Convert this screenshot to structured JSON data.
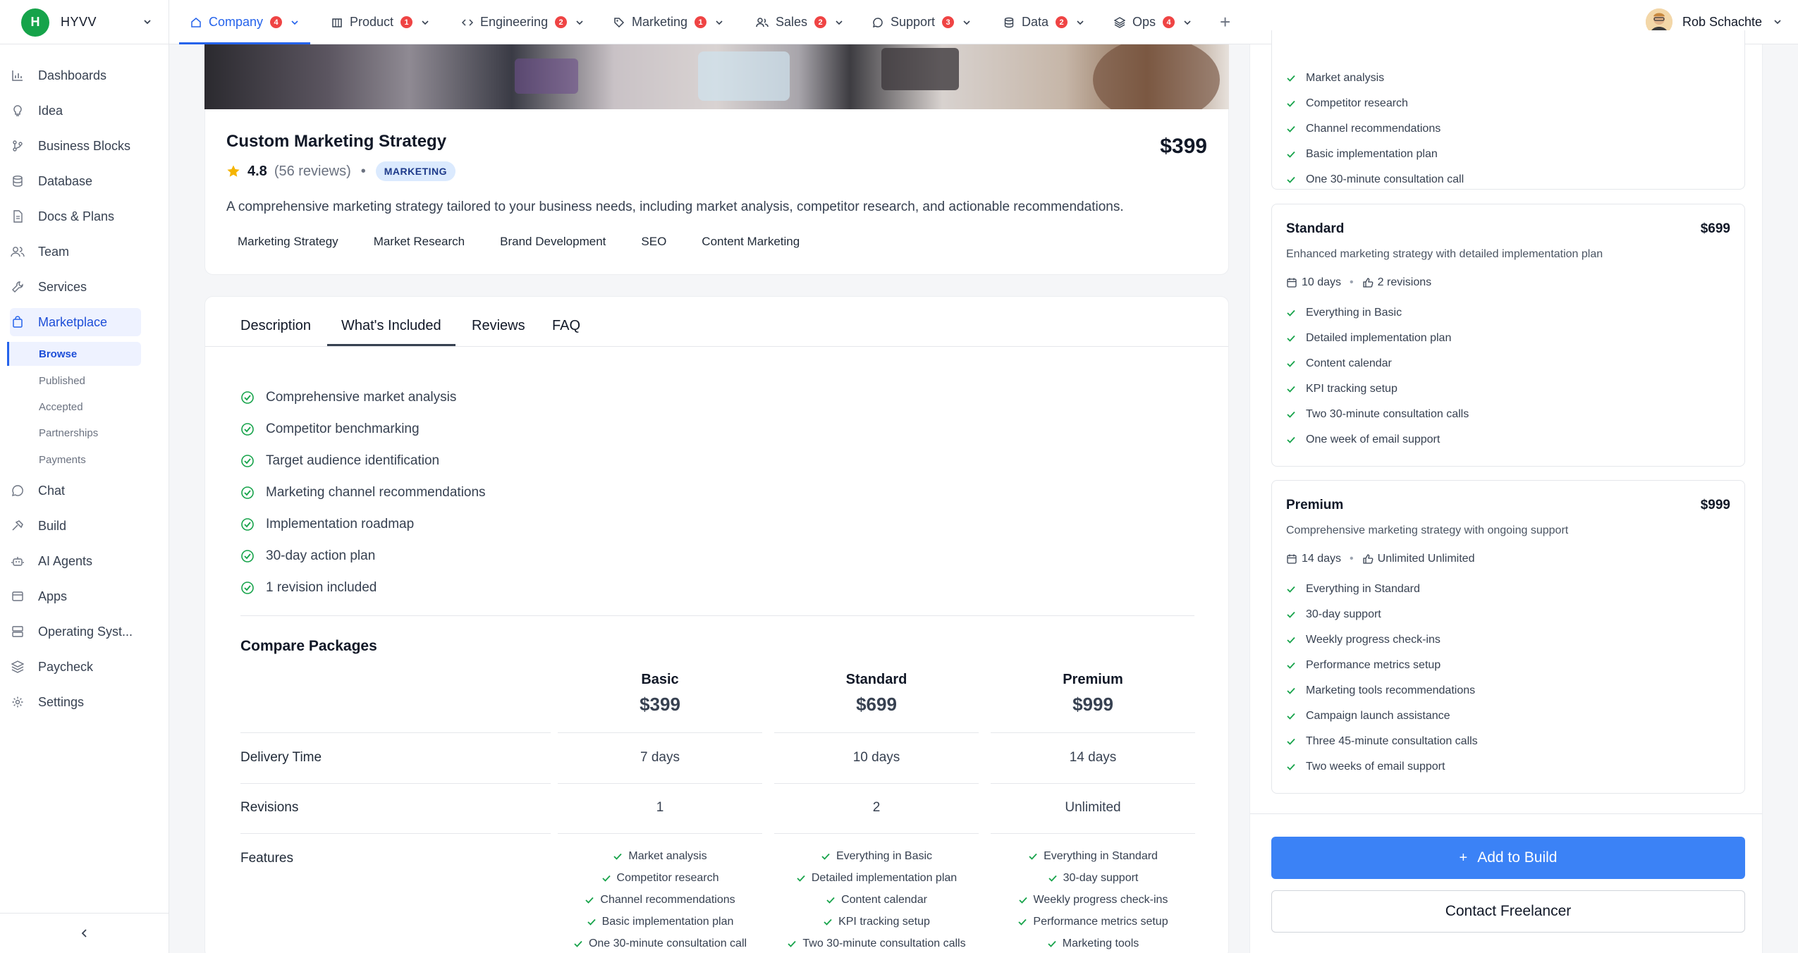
{
  "brand": {
    "initial": "H",
    "name": "HYVV"
  },
  "nav": {
    "tabs": [
      {
        "label": "Company",
        "badge": "4",
        "icon": "home-icon"
      },
      {
        "label": "Product",
        "badge": "1",
        "icon": "box-icon"
      },
      {
        "label": "Engineering",
        "badge": "2",
        "icon": "code-icon"
      },
      {
        "label": "Marketing",
        "badge": "1",
        "icon": "tag-icon"
      },
      {
        "label": "Sales",
        "badge": "2",
        "icon": "users-icon"
      },
      {
        "label": "Support",
        "badge": "3",
        "icon": "chat-bubble-icon"
      },
      {
        "label": "Data",
        "badge": "2",
        "icon": "database-icon"
      },
      {
        "label": "Ops",
        "badge": "4",
        "icon": "layers-icon"
      }
    ],
    "add_label": "+",
    "active_tab": "Company",
    "user_name": "Rob Schachte"
  },
  "sidebar": {
    "items": [
      {
        "label": "Dashboards",
        "icon": "bar-chart-icon"
      },
      {
        "label": "Idea",
        "icon": "lightbulb-icon"
      },
      {
        "label": "Business Blocks",
        "icon": "git-branch-icon"
      },
      {
        "label": "Database",
        "icon": "database-icon"
      },
      {
        "label": "Docs & Plans",
        "icon": "document-icon"
      },
      {
        "label": "Team",
        "icon": "users-icon"
      },
      {
        "label": "Services",
        "icon": "wrench-icon"
      },
      {
        "label": "Marketplace",
        "icon": "shopping-bag-icon"
      },
      {
        "label": "Chat",
        "icon": "chat-bubble-icon"
      },
      {
        "label": "Build",
        "icon": "hammer-icon"
      },
      {
        "label": "AI Agents",
        "icon": "robot-icon"
      },
      {
        "label": "Apps",
        "icon": "window-icon"
      },
      {
        "label": "Operating Syst...",
        "icon": "server-icon"
      },
      {
        "label": "Paycheck",
        "icon": "stack-icon"
      },
      {
        "label": "Settings",
        "icon": "gear-icon"
      }
    ],
    "sub_items": [
      "Browse",
      "Published",
      "Accepted",
      "Partnerships",
      "Payments"
    ],
    "active_item": "Marketplace",
    "active_sub": "Browse"
  },
  "product": {
    "title": "Custom Marketing Strategy",
    "price": "$399",
    "rating": "4.8",
    "reviews": "(56 reviews)",
    "separator": "•",
    "category": "MARKETING",
    "description": "A comprehensive marketing strategy tailored to your business needs, including market analysis, competitor research, and actionable recommendations.",
    "tags": [
      "Marketing Strategy",
      "Market Research",
      "Brand Development",
      "SEO",
      "Content Marketing"
    ]
  },
  "tabs": {
    "items": [
      "Description",
      "What's Included",
      "Reviews",
      "FAQ"
    ],
    "active": "What's Included"
  },
  "included": [
    "Comprehensive market analysis",
    "Competitor benchmarking",
    "Target audience identification",
    "Marketing channel recommendations",
    "Implementation roadmap",
    "30-day action plan",
    "1 revision included"
  ],
  "compare": {
    "title": "Compare Packages",
    "columns": [
      {
        "name": "Basic",
        "price": "$399",
        "delivery": "7 days",
        "revisions": "1",
        "features": [
          "Market analysis",
          "Competitor research",
          "Channel recommendations",
          "Basic implementation plan",
          "One 30-minute consultation call"
        ]
      },
      {
        "name": "Standard",
        "price": "$699",
        "delivery": "10 days",
        "revisions": "2",
        "features": [
          "Everything in Basic",
          "Detailed implementation plan",
          "Content calendar",
          "KPI tracking setup",
          "Two 30-minute consultation calls"
        ]
      },
      {
        "name": "Premium",
        "price": "$999",
        "delivery": "14 days",
        "revisions": "Unlimited",
        "features": [
          "Everything in Standard",
          "30-day support",
          "Weekly progress check-ins",
          "Performance metrics setup",
          "Marketing tools"
        ]
      }
    ],
    "row_labels": {
      "delivery": "Delivery Time",
      "revisions": "Revisions",
      "features": "Features"
    }
  },
  "packages": {
    "basic_partial": [
      "Market analysis",
      "Competitor research",
      "Channel recommendations",
      "Basic implementation plan",
      "One 30-minute consultation call"
    ],
    "standard": {
      "name": "Standard",
      "price": "$699",
      "description": "Enhanced marketing strategy with detailed implementation plan",
      "days": "10 days",
      "revisions": "2 revisions",
      "features": [
        "Everything in Basic",
        "Detailed implementation plan",
        "Content calendar",
        "KPI tracking setup",
        "Two 30-minute consultation calls",
        "One week of email support"
      ]
    },
    "premium": {
      "name": "Premium",
      "price": "$999",
      "description": "Comprehensive marketing strategy with ongoing support",
      "days": "14 days",
      "revisions": "Unlimited Unlimited",
      "features": [
        "Everything in Standard",
        "30-day support",
        "Weekly progress check-ins",
        "Performance metrics setup",
        "Marketing tools recommendations",
        "Campaign launch assistance",
        "Three 45-minute consultation calls",
        "Two weeks of email support"
      ]
    },
    "meta_separator": "•"
  },
  "actions": {
    "add_label": "Add to Build",
    "add_plus": "+",
    "contact_label": "Contact Freelancer"
  },
  "colors": {
    "accent": "#2563eb",
    "button": "#3b82f6",
    "check": "#16a34a",
    "badge": "#ef4444",
    "star": "#f5b400",
    "brand": "#16a34a"
  }
}
